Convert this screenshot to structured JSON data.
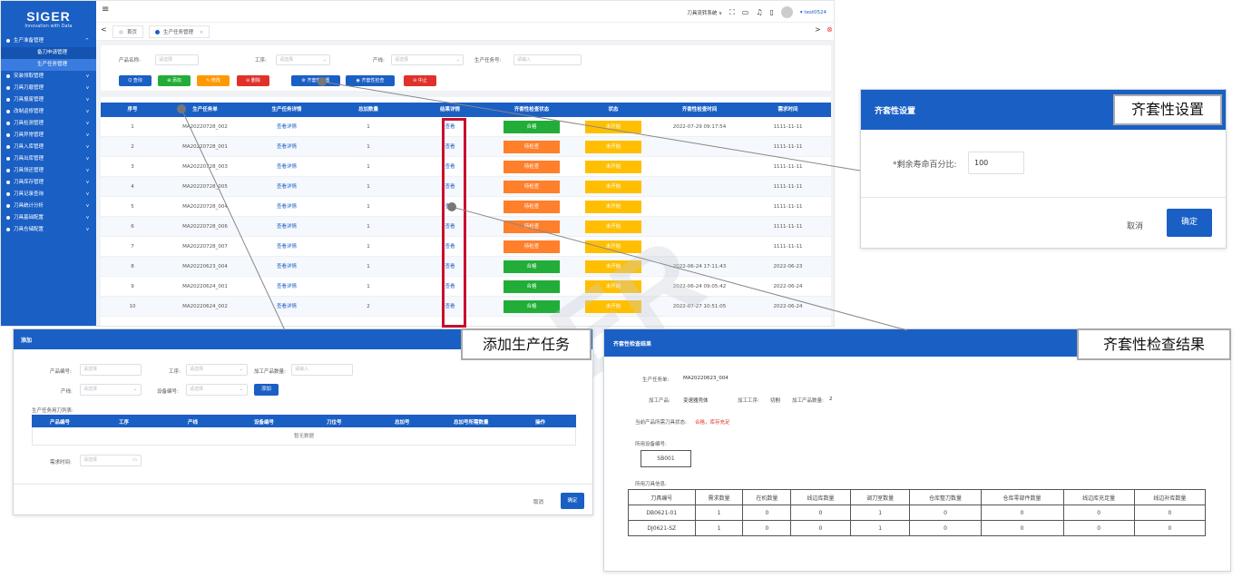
{
  "sidebar": {
    "logo": "SIGER",
    "tagline": "Innovation with Data",
    "menu": [
      {
        "label": "生产准备管理",
        "chev": "^"
      },
      {
        "label": "安装领取管理",
        "chev": "v"
      },
      {
        "label": "刀具刃磨管理",
        "chev": "v"
      },
      {
        "label": "刀具报废管理",
        "chev": "v"
      },
      {
        "label": "改制返修管理",
        "chev": "v"
      },
      {
        "label": "刀具检测管理",
        "chev": "v"
      },
      {
        "label": "刀具异常管理",
        "chev": "v"
      },
      {
        "label": "刀具入库管理",
        "chev": "v"
      },
      {
        "label": "刀具出库管理",
        "chev": "v"
      },
      {
        "label": "刀具领还管理",
        "chev": "v"
      },
      {
        "label": "刀具库存管理",
        "chev": "v"
      },
      {
        "label": "刀具记录查询",
        "chev": "v"
      },
      {
        "label": "刀具统计分析",
        "chev": "v"
      },
      {
        "label": "刀具基础配置",
        "chev": "v"
      },
      {
        "label": "刀具仓储配置",
        "chev": "v"
      }
    ],
    "submenu": [
      {
        "label": "备刀申请管理"
      },
      {
        "label": "生产任务管理"
      }
    ]
  },
  "topbar": {
    "menu_icon": "≡",
    "system": "刀具流转系统 ∨",
    "user": "▾ test0524"
  },
  "tabs": {
    "home": "首页",
    "current": "生产任务管理",
    "close": "×",
    "left": "<",
    "right": ">",
    "close_all": "⊗"
  },
  "filters": {
    "product_label": "产品名称:",
    "product_ph": "请选择",
    "process_label": "工序:",
    "process_ph": "请选择",
    "line_label": "产线:",
    "line_ph": "请选择",
    "task_label": "生产任务号:",
    "task_ph": "请输入"
  },
  "actions": {
    "query": "Q 查询",
    "add": "⊕ 添加",
    "edit": "✎ 修改",
    "delete": "⊖ 删除",
    "kit_setting": "⚙ 齐套性设置",
    "kit_check": "◉ 齐套性检查",
    "stop": "⊖ 中止"
  },
  "table": {
    "headers": [
      "序号",
      "生产任务单",
      "生产任务详情",
      "总加数量",
      "结果详情",
      "齐套性检查状态",
      "状态",
      "齐套性检查时间",
      "需求时间"
    ],
    "rows": [
      {
        "no": "1",
        "task": "MA20220728_002",
        "detail": "查看详情",
        "qty": "1",
        "result": "查看",
        "check": "合格",
        "status": "未开始",
        "time": "2022-07-29 09:17:54",
        "need": "1111-11-11"
      },
      {
        "no": "2",
        "task": "MA20220728_001",
        "detail": "查看详情",
        "qty": "1",
        "result": "查看",
        "check": "待检查",
        "status": "未开始",
        "time": "",
        "need": "1111-11-11"
      },
      {
        "no": "3",
        "task": "MA20220728_003",
        "detail": "查看详情",
        "qty": "1",
        "result": "查看",
        "check": "待检查",
        "status": "未开始",
        "time": "",
        "need": "1111-11-11"
      },
      {
        "no": "4",
        "task": "MA20220728_005",
        "detail": "查看详情",
        "qty": "1",
        "result": "查看",
        "check": "待检查",
        "status": "未开始",
        "time": "",
        "need": "1111-11-11"
      },
      {
        "no": "5",
        "task": "MA20220728_004",
        "detail": "查看详情",
        "qty": "1",
        "result": "查看",
        "check": "待检查",
        "status": "未开始",
        "time": "",
        "need": "1111-11-11"
      },
      {
        "no": "6",
        "task": "MA20220728_006",
        "detail": "查看详情",
        "qty": "1",
        "result": "查看",
        "check": "待检查",
        "status": "未开始",
        "time": "",
        "need": "1111-11-11"
      },
      {
        "no": "7",
        "task": "MA20220728_007",
        "detail": "查看详情",
        "qty": "1",
        "result": "查看",
        "check": "待检查",
        "status": "未开始",
        "time": "",
        "need": "1111-11-11"
      },
      {
        "no": "8",
        "task": "MA20220623_004",
        "detail": "查看详情",
        "qty": "1",
        "result": "查看",
        "check": "合格",
        "status": "未开始",
        "time": "2022-06-24 17:11:43",
        "need": "2022-06-23"
      },
      {
        "no": "9",
        "task": "MA20220624_001",
        "detail": "查看详情",
        "qty": "1",
        "result": "查看",
        "check": "合格",
        "status": "未开始",
        "time": "2022-06-24 09:05:42",
        "need": "2022-06-24"
      },
      {
        "no": "10",
        "task": "MA20220624_002",
        "detail": "查看详情",
        "qty": "2",
        "result": "查看",
        "check": "合格",
        "status": "未开始",
        "time": "2022-07-27 10:51:05",
        "need": "2022-06-24"
      }
    ]
  },
  "kit_setting": {
    "title": "齐套性设置",
    "callout": "齐套性设置",
    "field_label": "*剩余寿命百分比:",
    "field_value": "100",
    "cancel": "取消",
    "confirm": "确定"
  },
  "add_task": {
    "title": "添加",
    "callout": "添加生产任务",
    "product_no_label": "产品编号:",
    "product_no_ph": "请选择",
    "process_label": "工序:",
    "process_ph": "请选择",
    "qty_label": "加工产品数量:",
    "qty_ph": "请输入",
    "line_label": "产线:",
    "line_ph": "请选择",
    "device_label": "设备编号:",
    "device_ph": "请选择",
    "add_btn": "添加",
    "list_label": "生产任务用刀列表:",
    "headers": [
      "产品编号",
      "工序",
      "产线",
      "设备编号",
      "刀位号",
      "总加号",
      "总加号所需数量",
      "操作"
    ],
    "empty": "暂无数据",
    "need_label": "需求时间:",
    "need_ph": "请选择",
    "calendar": "▭",
    "cancel": "取消",
    "confirm": "确定"
  },
  "kit_result": {
    "title": "齐套性检查结果",
    "callout": "齐套性检查结果",
    "task_label": "生产任务单:",
    "task_value": "MA20220623_004",
    "product_label": "加工产品:",
    "product_value": "变速器壳体",
    "process_label": "加工工序:",
    "process_value": "切削",
    "qty_label": "加工产品数量:",
    "qty_value": "2",
    "state_label": "当前产品所需刀具状态:",
    "state_value": "合格，库存充足",
    "device_label": "所用设备编号:",
    "device_value": "SB001",
    "tools_label": "所用刀具信息:",
    "headers": [
      "刀具编号",
      "需求数量",
      "在机数量",
      "线边库数量",
      "调刀室数量",
      "仓库整刀数量",
      "仓库零部件数量",
      "线边库充足量",
      "线边补库数量"
    ],
    "rows": [
      [
        "DB0621-01",
        "1",
        "0",
        "0",
        "1",
        "0",
        "0",
        "0",
        "0"
      ],
      [
        "DJ0621-SZ",
        "1",
        "0",
        "0",
        "1",
        "0",
        "0",
        "0",
        "0"
      ]
    ]
  },
  "watermark": "SIGER",
  "colors": {
    "primary": "#1a5fc4",
    "ok": "#22ad38",
    "pending": "#ff7f2a",
    "not_started": "#ffbf00",
    "highlight": "#c8102e"
  }
}
